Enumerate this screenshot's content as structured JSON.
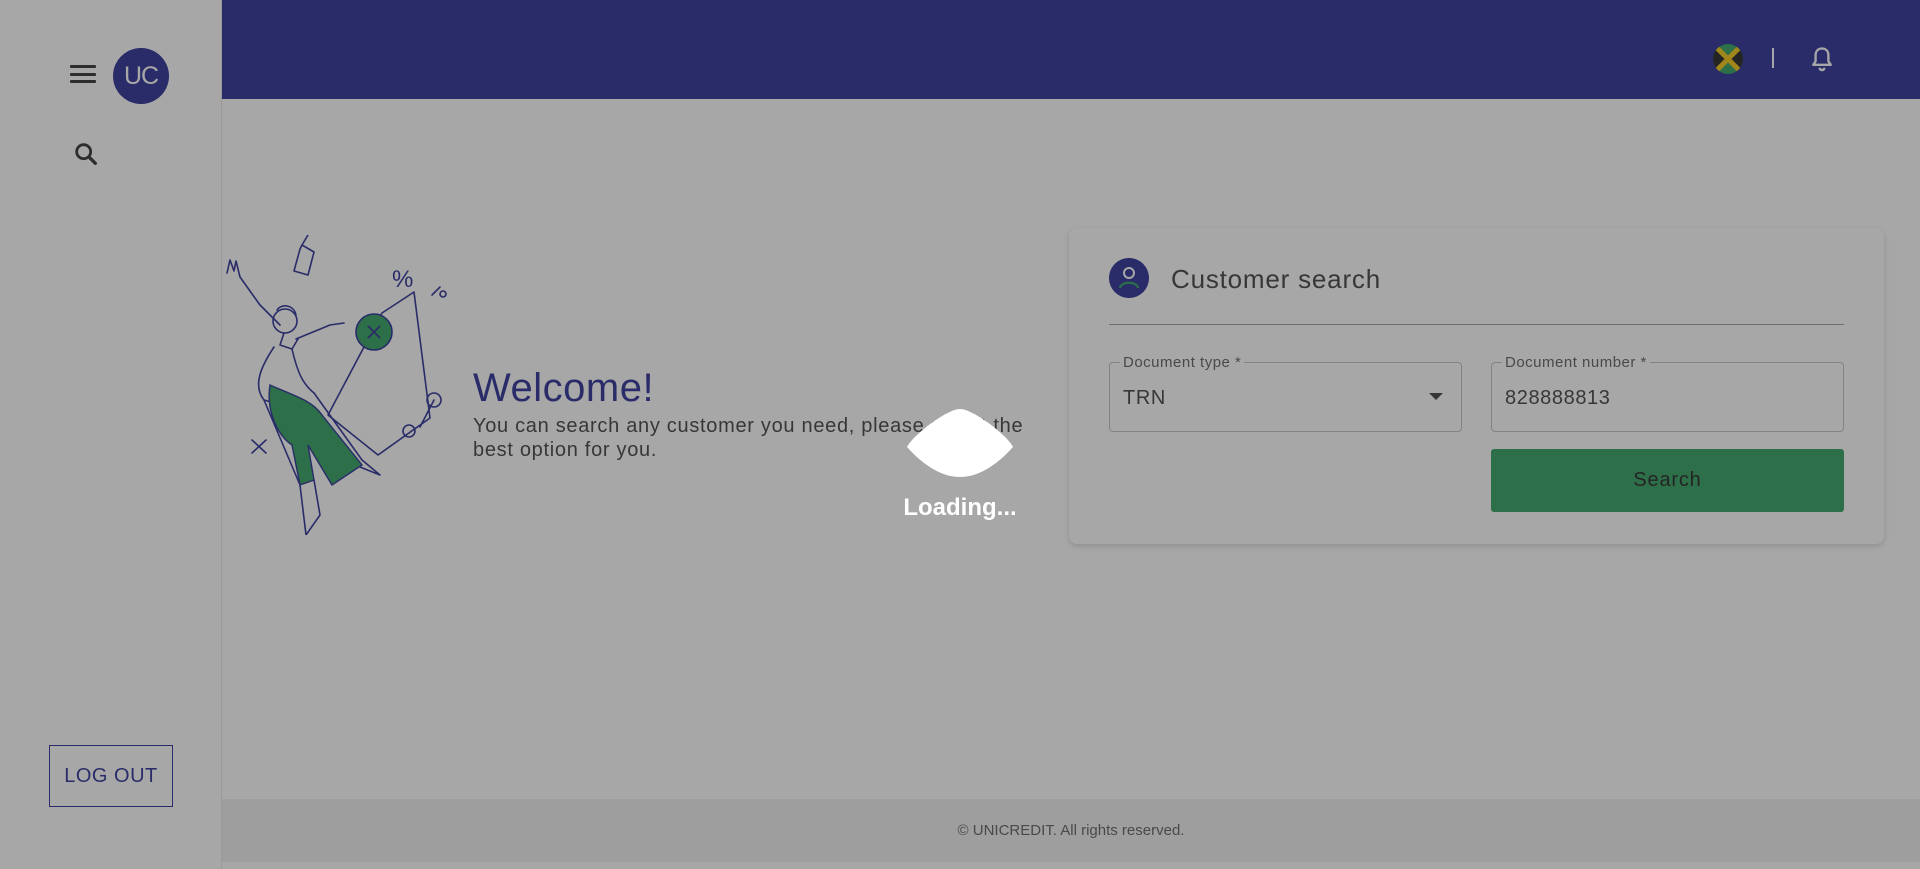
{
  "sidebar": {
    "avatar_text": "UC",
    "menu_icon": "menu-icon",
    "search_icon": "search-icon",
    "logout_label": "LOG OUT"
  },
  "header": {
    "flag_icon": "jamaica-flag-icon",
    "divider_text": "",
    "notification_icon": "bell-icon",
    "bg_color": "#1a1f8c"
  },
  "welcome": {
    "title": "Welcome!",
    "text": "You can search any customer you need, please select the best option for you."
  },
  "customer_search": {
    "title": "Customer search",
    "document_type": {
      "label": "Document type *",
      "value": "TRN"
    },
    "document_number": {
      "label": "Document number *",
      "value": "828888813"
    },
    "search_label": "Search",
    "accent_color": "#1f9a55"
  },
  "footer": {
    "text": "© UNICREDIT. All rights reserved."
  },
  "loading": {
    "text": "Loading..."
  }
}
